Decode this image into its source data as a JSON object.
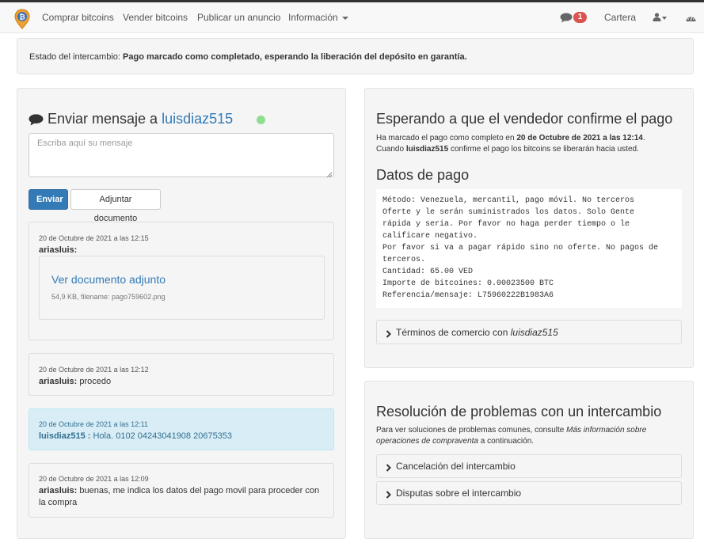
{
  "navbar": {
    "buy": "Comprar bitcoins",
    "sell": "Vender bitcoins",
    "post_ad": "Publicar un anuncio",
    "info": "Información",
    "notifications_count": "1",
    "wallet": "Cartera"
  },
  "status": {
    "label": "Estado del intercambio:",
    "value": "Pago marcado como completado, esperando la liberación del depósito en garantía."
  },
  "chat": {
    "title_prefix": "Enviar mensaje a",
    "partner": "luisdiaz515",
    "online_color": "#8fdd8f",
    "placeholder": "Escriba aquí su mensaje",
    "send_label": "Enviar",
    "attach_label": "Adjuntar documento",
    "messages": [
      {
        "date": "20 de Octubre de 2021 a las 12:15",
        "author": "ariasluis:",
        "text": "",
        "attachment": {
          "link": "Ver documento adjunto",
          "meta": "54,9 KB, filename: pago759602.png"
        }
      },
      {
        "date": "20 de Octubre de 2021 a las 12:12",
        "author": "ariasluis:",
        "text": "procedo"
      },
      {
        "date": "20 de Octubre de 2021 a las 12:11",
        "author": "luisdiaz515 :",
        "text": "Hola. 0102 04243041908 20675353"
      },
      {
        "date": "20 de Octubre de 2021 a las 12:09",
        "author": "ariasluis:",
        "text": "buenas, me indica los datos del pago movil para proceder con la compra"
      }
    ]
  },
  "payment": {
    "title": "Esperando a que el vendedor confirme el pago",
    "line1_prefix": "Ha marcado el pago como completo en",
    "line1_date": "20 de Octubre de 2021 a las 12:14",
    "line2_prefix": "Cuando",
    "line2_user": "luisdiaz515",
    "line2_suffix": "confirme el pago los bitcoins se liberarán hacia usted.",
    "data_title": "Datos de pago",
    "details": "Método: Venezuela, mercantil, pago móvil. No terceros\nOferte y le serán suministrados los datos. Solo Gente\nrápida y seria. Por favor no haga perder tiempo o le\ncalificare negativo.\nPor favor si va a pagar rápido sino no oferte. No pagos de\nterceros.\nCantidad: 65.00 VED\nImporte de bitcoines: 0.00023500 BTC\nReferencia/mensaje: L75960222B1983A6",
    "terms_prefix": "Términos de comercio con",
    "terms_user": "luisdiaz515"
  },
  "resolution": {
    "title": "Resolución de problemas con un intercambio",
    "text_prefix": "Para ver soluciones de problemas comunes, consulte",
    "text_link": "Más información sobre operaciones de compraventa",
    "text_suffix": "a continuación.",
    "cancel_label": "Cancelación del intercambio",
    "disputes_label": "Disputas sobre el intercambio"
  }
}
